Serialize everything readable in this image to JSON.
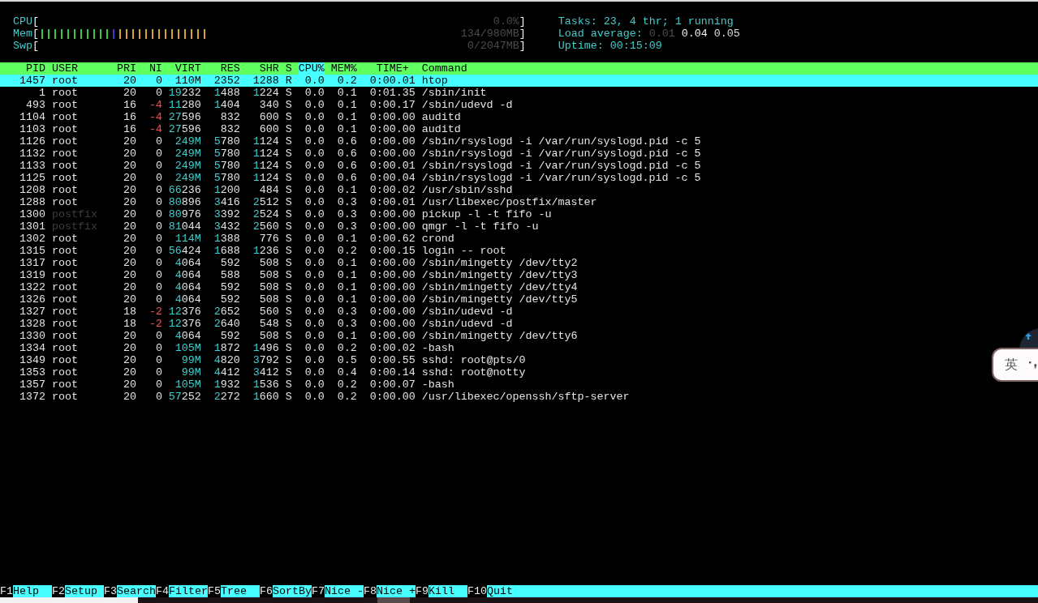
{
  "meters": [
    {
      "label": "CPU",
      "open": "[",
      "reading": "0.0%",
      "close": "]"
    },
    {
      "label": "Mem",
      "open": "[",
      "segments": [
        {
          "level": 0.149,
          "color": "#3fc43f"
        },
        {
          "level": 0.0135,
          "color": "#3a3ad0"
        },
        {
          "level": 0.189,
          "color": "#d4a63a"
        }
      ],
      "reading": "134/980MB",
      "close": "]"
    },
    {
      "label": "Swp",
      "open": "[",
      "reading": "0/2047MB",
      "close": "]"
    }
  ],
  "summary": {
    "tasks": "Tasks: 23, 4 thr; 1 running",
    "load_label": "Load average:",
    "load_values": [
      "0.01",
      "0.04",
      "0.05"
    ],
    "uptime_label": "Uptime:",
    "uptime": "00:15:09"
  },
  "table": {
    "columns": [
      {
        "label": "PID",
        "selected": false
      },
      {
        "label": "USER",
        "selected": false
      },
      {
        "label": "PRI",
        "selected": false
      },
      {
        "label": "NI",
        "selected": false
      },
      {
        "label": "VIRT",
        "selected": false
      },
      {
        "label": "RES",
        "selected": false
      },
      {
        "label": "SHR",
        "selected": false
      },
      {
        "label": "S",
        "selected": false
      },
      {
        "label": "CPU%",
        "selected": true
      },
      {
        "label": "MEM%",
        "selected": false
      },
      {
        "label": "TIME+",
        "selected": false
      },
      {
        "label": "Command",
        "selected": false
      }
    ],
    "rows": [
      {
        "pid": "1457",
        "user": "root",
        "user_dimmed": false,
        "pri": "20",
        "ni": "0",
        "virt": "110M",
        "res": "2352",
        "shr": "1288",
        "state": "R",
        "cpu": "0.0",
        "mem": "0.2",
        "time": "0:00.01",
        "command": "htop",
        "selected": true
      },
      {
        "pid": "1",
        "user": "root",
        "user_dimmed": false,
        "pri": "20",
        "ni": "0",
        "virt": "19232",
        "res": "1488",
        "shr": "1224",
        "state": "S",
        "cpu": "0.0",
        "mem": "0.1",
        "time": "0:01.35",
        "command": "/sbin/init",
        "selected": false
      },
      {
        "pid": "493",
        "user": "root",
        "user_dimmed": false,
        "pri": "16",
        "ni": "-4",
        "virt": "11280",
        "res": "1404",
        "shr": "340",
        "state": "S",
        "cpu": "0.0",
        "mem": "0.1",
        "time": "0:00.17",
        "command": "/sbin/udevd -d",
        "selected": false
      },
      {
        "pid": "1104",
        "user": "root",
        "user_dimmed": false,
        "pri": "16",
        "ni": "-4",
        "virt": "27596",
        "res": "832",
        "shr": "600",
        "state": "S",
        "cpu": "0.0",
        "mem": "0.1",
        "time": "0:00.00",
        "command": "auditd",
        "selected": false
      },
      {
        "pid": "1103",
        "user": "root",
        "user_dimmed": false,
        "pri": "16",
        "ni": "-4",
        "virt": "27596",
        "res": "832",
        "shr": "600",
        "state": "S",
        "cpu": "0.0",
        "mem": "0.1",
        "time": "0:00.00",
        "command": "auditd",
        "selected": false
      },
      {
        "pid": "1126",
        "user": "root",
        "user_dimmed": false,
        "pri": "20",
        "ni": "0",
        "virt": "249M",
        "res": "5780",
        "shr": "1124",
        "state": "S",
        "cpu": "0.0",
        "mem": "0.6",
        "time": "0:00.00",
        "command": "/sbin/rsyslogd -i /var/run/syslogd.pid -c 5",
        "selected": false
      },
      {
        "pid": "1132",
        "user": "root",
        "user_dimmed": false,
        "pri": "20",
        "ni": "0",
        "virt": "249M",
        "res": "5780",
        "shr": "1124",
        "state": "S",
        "cpu": "0.0",
        "mem": "0.6",
        "time": "0:00.00",
        "command": "/sbin/rsyslogd -i /var/run/syslogd.pid -c 5",
        "selected": false
      },
      {
        "pid": "1133",
        "user": "root",
        "user_dimmed": false,
        "pri": "20",
        "ni": "0",
        "virt": "249M",
        "res": "5780",
        "shr": "1124",
        "state": "S",
        "cpu": "0.0",
        "mem": "0.6",
        "time": "0:00.01",
        "command": "/sbin/rsyslogd -i /var/run/syslogd.pid -c 5",
        "selected": false
      },
      {
        "pid": "1125",
        "user": "root",
        "user_dimmed": false,
        "pri": "20",
        "ni": "0",
        "virt": "249M",
        "res": "5780",
        "shr": "1124",
        "state": "S",
        "cpu": "0.0",
        "mem": "0.6",
        "time": "0:00.04",
        "command": "/sbin/rsyslogd -i /var/run/syslogd.pid -c 5",
        "selected": false
      },
      {
        "pid": "1208",
        "user": "root",
        "user_dimmed": false,
        "pri": "20",
        "ni": "0",
        "virt": "66236",
        "res": "1200",
        "shr": "484",
        "state": "S",
        "cpu": "0.0",
        "mem": "0.1",
        "time": "0:00.02",
        "command": "/usr/sbin/sshd",
        "selected": false
      },
      {
        "pid": "1288",
        "user": "root",
        "user_dimmed": false,
        "pri": "20",
        "ni": "0",
        "virt": "80896",
        "res": "3416",
        "shr": "2512",
        "state": "S",
        "cpu": "0.0",
        "mem": "0.3",
        "time": "0:00.01",
        "command": "/usr/libexec/postfix/master",
        "selected": false
      },
      {
        "pid": "1300",
        "user": "postfix",
        "user_dimmed": true,
        "pri": "20",
        "ni": "0",
        "virt": "80976",
        "res": "3392",
        "shr": "2524",
        "state": "S",
        "cpu": "0.0",
        "mem": "0.3",
        "time": "0:00.00",
        "command": "pickup -l -t fifo -u",
        "selected": false
      },
      {
        "pid": "1301",
        "user": "postfix",
        "user_dimmed": true,
        "pri": "20",
        "ni": "0",
        "virt": "81044",
        "res": "3432",
        "shr": "2560",
        "state": "S",
        "cpu": "0.0",
        "mem": "0.3",
        "time": "0:00.00",
        "command": "qmgr -l -t fifo -u",
        "selected": false
      },
      {
        "pid": "1302",
        "user": "root",
        "user_dimmed": false,
        "pri": "20",
        "ni": "0",
        "virt": "114M",
        "res": "1388",
        "shr": "776",
        "state": "S",
        "cpu": "0.0",
        "mem": "0.1",
        "time": "0:00.62",
        "command": "crond",
        "selected": false
      },
      {
        "pid": "1315",
        "user": "root",
        "user_dimmed": false,
        "pri": "20",
        "ni": "0",
        "virt": "56424",
        "res": "1688",
        "shr": "1236",
        "state": "S",
        "cpu": "0.0",
        "mem": "0.2",
        "time": "0:00.15",
        "command": "login -- root",
        "selected": false
      },
      {
        "pid": "1317",
        "user": "root",
        "user_dimmed": false,
        "pri": "20",
        "ni": "0",
        "virt": "4064",
        "res": "592",
        "shr": "508",
        "state": "S",
        "cpu": "0.0",
        "mem": "0.1",
        "time": "0:00.00",
        "command": "/sbin/mingetty /dev/tty2",
        "selected": false
      },
      {
        "pid": "1319",
        "user": "root",
        "user_dimmed": false,
        "pri": "20",
        "ni": "0",
        "virt": "4064",
        "res": "588",
        "shr": "508",
        "state": "S",
        "cpu": "0.0",
        "mem": "0.1",
        "time": "0:00.00",
        "command": "/sbin/mingetty /dev/tty3",
        "selected": false
      },
      {
        "pid": "1322",
        "user": "root",
        "user_dimmed": false,
        "pri": "20",
        "ni": "0",
        "virt": "4064",
        "res": "592",
        "shr": "508",
        "state": "S",
        "cpu": "0.0",
        "mem": "0.1",
        "time": "0:00.00",
        "command": "/sbin/mingetty /dev/tty4",
        "selected": false
      },
      {
        "pid": "1326",
        "user": "root",
        "user_dimmed": false,
        "pri": "20",
        "ni": "0",
        "virt": "4064",
        "res": "592",
        "shr": "508",
        "state": "S",
        "cpu": "0.0",
        "mem": "0.1",
        "time": "0:00.00",
        "command": "/sbin/mingetty /dev/tty5",
        "selected": false
      },
      {
        "pid": "1327",
        "user": "root",
        "user_dimmed": false,
        "pri": "18",
        "ni": "-2",
        "virt": "12376",
        "res": "2652",
        "shr": "560",
        "state": "S",
        "cpu": "0.0",
        "mem": "0.3",
        "time": "0:00.00",
        "command": "/sbin/udevd -d",
        "selected": false
      },
      {
        "pid": "1328",
        "user": "root",
        "user_dimmed": false,
        "pri": "18",
        "ni": "-2",
        "virt": "12376",
        "res": "2640",
        "shr": "548",
        "state": "S",
        "cpu": "0.0",
        "mem": "0.3",
        "time": "0:00.00",
        "command": "/sbin/udevd -d",
        "selected": false
      },
      {
        "pid": "1330",
        "user": "root",
        "user_dimmed": false,
        "pri": "20",
        "ni": "0",
        "virt": "4064",
        "res": "592",
        "shr": "508",
        "state": "S",
        "cpu": "0.0",
        "mem": "0.1",
        "time": "0:00.00",
        "command": "/sbin/mingetty /dev/tty6",
        "selected": false
      },
      {
        "pid": "1334",
        "user": "root",
        "user_dimmed": false,
        "pri": "20",
        "ni": "0",
        "virt": "105M",
        "res": "1872",
        "shr": "1496",
        "state": "S",
        "cpu": "0.0",
        "mem": "0.2",
        "time": "0:00.02",
        "command": "-bash",
        "selected": false
      },
      {
        "pid": "1349",
        "user": "root",
        "user_dimmed": false,
        "pri": "20",
        "ni": "0",
        "virt": "99M",
        "res": "4820",
        "shr": "3792",
        "state": "S",
        "cpu": "0.0",
        "mem": "0.5",
        "time": "0:00.55",
        "command": "sshd: root@pts/0",
        "selected": false
      },
      {
        "pid": "1353",
        "user": "root",
        "user_dimmed": false,
        "pri": "20",
        "ni": "0",
        "virt": "99M",
        "res": "4412",
        "shr": "3412",
        "state": "S",
        "cpu": "0.0",
        "mem": "0.4",
        "time": "0:00.14",
        "command": "sshd: root@notty",
        "selected": false
      },
      {
        "pid": "1357",
        "user": "root",
        "user_dimmed": false,
        "pri": "20",
        "ni": "0",
        "virt": "105M",
        "res": "1932",
        "shr": "1536",
        "state": "S",
        "cpu": "0.0",
        "mem": "0.2",
        "time": "0:00.07",
        "command": "-bash",
        "selected": false
      },
      {
        "pid": "1372",
        "user": "root",
        "user_dimmed": false,
        "pri": "20",
        "ni": "0",
        "virt": "57252",
        "res": "2272",
        "shr": "1660",
        "state": "S",
        "cpu": "0.0",
        "mem": "0.2",
        "time": "0:00.00",
        "command": "/usr/libexec/openssh/sftp-server",
        "selected": false
      }
    ]
  },
  "function_keys": [
    {
      "key": "F1",
      "label": "Help"
    },
    {
      "key": "F2",
      "label": "Setup"
    },
    {
      "key": "F3",
      "label": "Search"
    },
    {
      "key": "F4",
      "label": "Filter"
    },
    {
      "key": "F5",
      "label": "Tree"
    },
    {
      "key": "F6",
      "label": "SortBy"
    },
    {
      "key": "F7",
      "label": "Nice -"
    },
    {
      "key": "F8",
      "label": "Nice +"
    },
    {
      "key": "F9",
      "label": "Kill"
    },
    {
      "key": "F10",
      "label": "Quit"
    }
  ],
  "ime_toolbar": {
    "mode": "英"
  }
}
